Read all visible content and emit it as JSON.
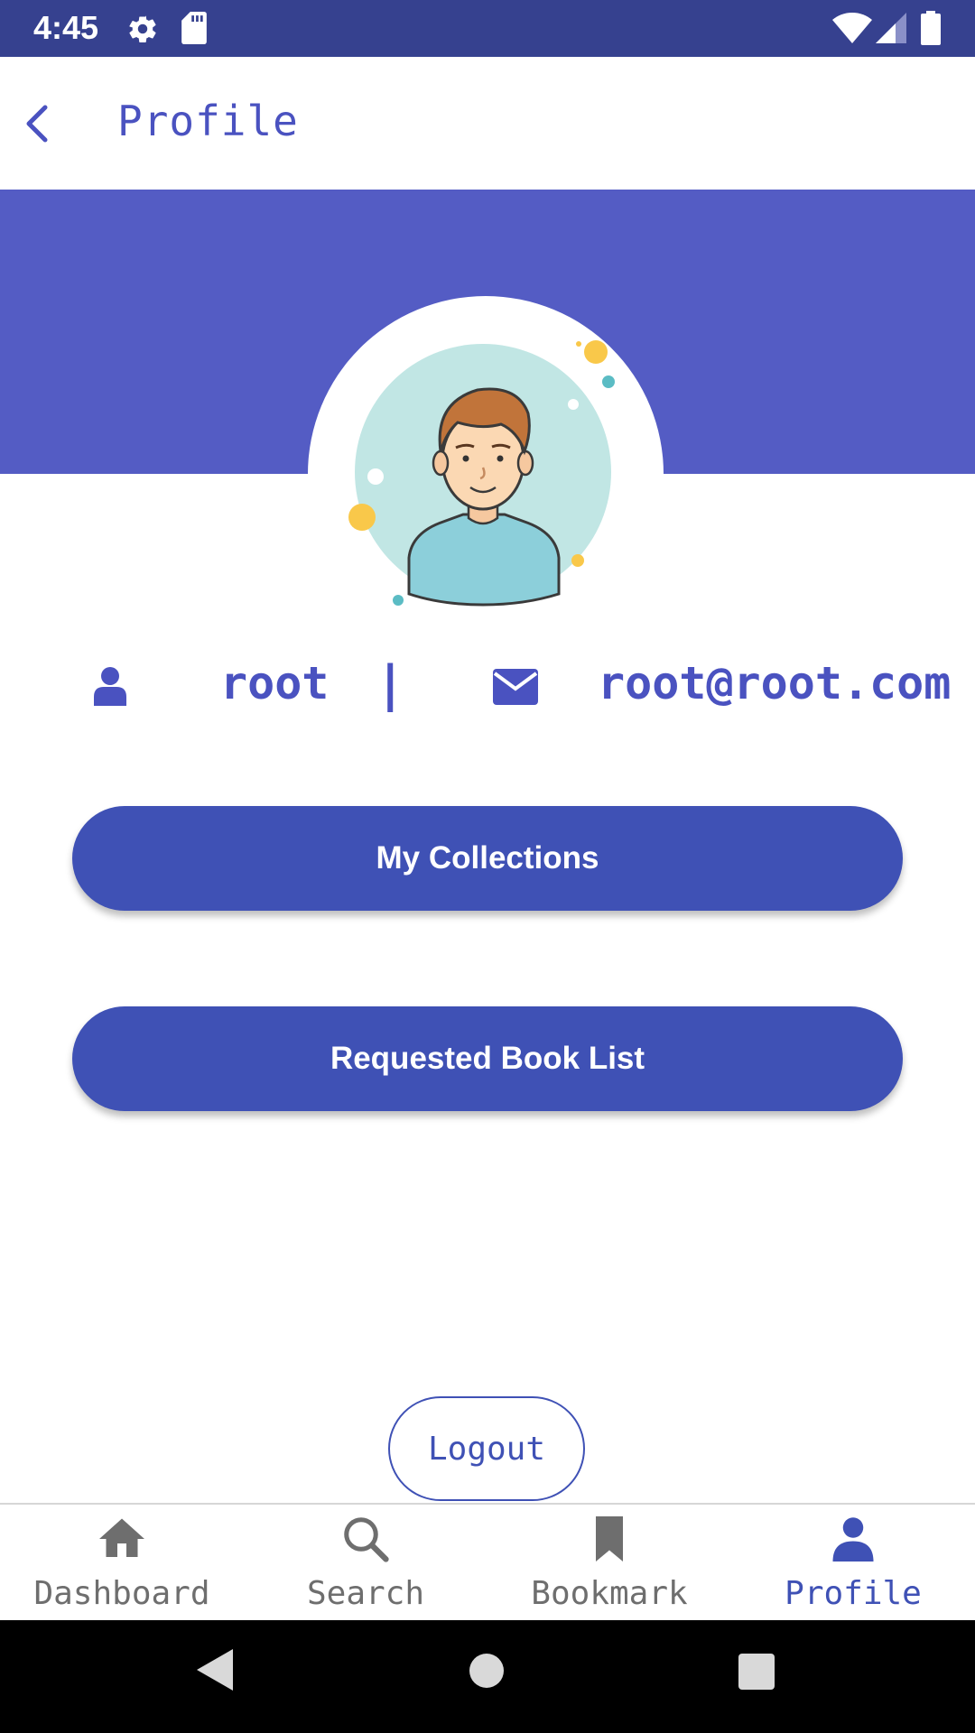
{
  "status_bar": {
    "time": "4:45"
  },
  "app_bar": {
    "title": "Profile"
  },
  "profile": {
    "username": "root",
    "separator": "|",
    "email": "root@root.com"
  },
  "actions": {
    "collections_label": "My Collections",
    "requested_label": "Requested Book List",
    "logout_label": "Logout"
  },
  "bottom_nav": {
    "items": [
      {
        "label": "Dashboard",
        "icon": "home-icon",
        "active": false
      },
      {
        "label": "Search",
        "icon": "search-icon",
        "active": false
      },
      {
        "label": "Bookmark",
        "icon": "bookmark-icon",
        "active": false
      },
      {
        "label": "Profile",
        "icon": "person-icon",
        "active": true
      }
    ]
  },
  "colors": {
    "primary": "#3f51b5",
    "banner": "#545cc4",
    "status_bar": "#36418f",
    "text_primary": "#4a52c0",
    "inactive": "#6e6e6e"
  }
}
